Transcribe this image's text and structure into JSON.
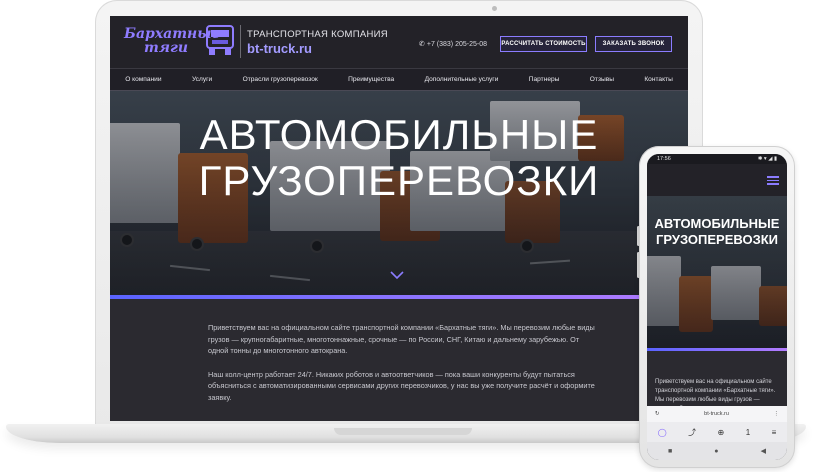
{
  "site": {
    "logo_line1": "Бархатные",
    "logo_line2": "тяги",
    "company_subtitle": "ТРАНСПОРТНАЯ КОМПАНИЯ",
    "company_url": "bt-truck.ru",
    "phone": "+7 (383) 205-25-08",
    "btn_calc": "РАССЧИТАТЬ СТОИМОСТЬ",
    "btn_call": "ЗАКАЗАТЬ ЗВОНОК",
    "nav": [
      "О компании",
      "Услуги",
      "Отрасли грузоперевозок",
      "Преимущества",
      "Дополнительные услуги",
      "Партнеры",
      "Отзывы",
      "Контакты"
    ],
    "hero_line1": "АВТОМОБИЛЬНЫЕ",
    "hero_line2": "ГРУЗОПЕРЕВОЗКИ",
    "intro_p1": "Приветствуем вас на официальном сайте транспортной компании «Бархатные тяги». Мы перевозим любые виды грузов — крупногабаритные, многотоннажные, срочные — по России, СНГ, Китаю и дальнему зарубежью. От одной тонны до многотонного автокрана.",
    "intro_p2": "Наш колл-центр работает 24/7. Никаких роботов и автоответчиков — пока ваши конкуренты будут пытаться объясниться с автоматизированными сервисами других перевозчиков, у нас вы уже получите расчёт и оформите заявку."
  },
  "mobile": {
    "time": "17:56",
    "status_icons": "✱ ▾ ◢ ▮",
    "hero_line1": "АВТОМОБИЛЬНЫЕ",
    "hero_line2": "ГРУЗОПЕРЕВОЗКИ",
    "intro": "Приветствуем вас на официальном сайте транспортной компании «Бархатные тяги». Мы перевозим любые виды грузов — крупногабаритные,",
    "url": "bt-truck.ru",
    "reload_icon": "↻",
    "menu_dots": "⋮",
    "nav_icons": [
      "◯",
      "⤴",
      "⊕",
      "1",
      "≡"
    ],
    "sys_icons": [
      "■",
      "●",
      "◀"
    ]
  },
  "colors": {
    "accent": "#8b7cff",
    "background": "#2b2a30"
  }
}
